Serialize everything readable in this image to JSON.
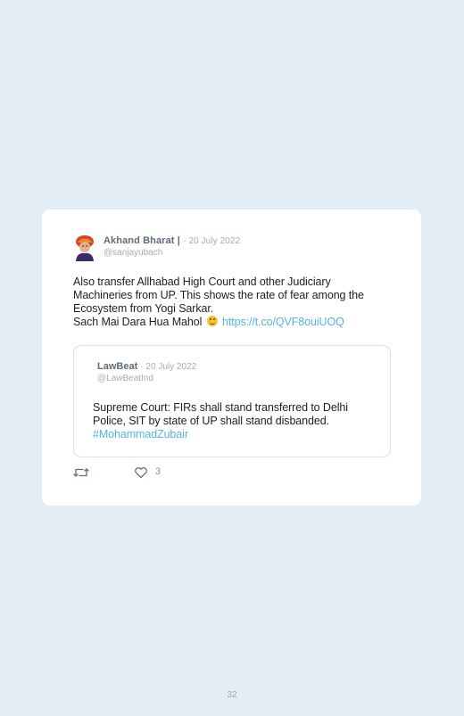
{
  "tweet": {
    "author_name": "Akhand Bharat |",
    "date": "· 20 July 2022",
    "handle": "@sanjayubach",
    "text_line1": "Also transfer Allhabad High Court and other Judiciary",
    "text_line2": "Machineries from UP. This shows the rate of fear among the",
    "text_line3": "Ecosystem from Yogi Sarkar.",
    "text_line4": "Sach Mai Dara Hua Mahol",
    "link": "https://t.co/QVF8ouiUOQ",
    "likes": "3"
  },
  "quoted": {
    "author_name": "LawBeat",
    "date": "· 20 July 2022",
    "handle": "@LawBeatInd",
    "text_line1": "Supreme Court: FIRs shall stand transferred to Delhi",
    "text_line2": "Police, SIT by state of UP shall stand disbanded.",
    "hashtag": "#MohammadZubair"
  },
  "page": {
    "number": "32"
  },
  "icons": {
    "retweet": "retweet-icon",
    "like": "heart-icon",
    "emoji": "grinning-face-emoji"
  },
  "colors": {
    "background": "#e2edf5",
    "link": "#55b3e6",
    "card": "#ffffff"
  }
}
